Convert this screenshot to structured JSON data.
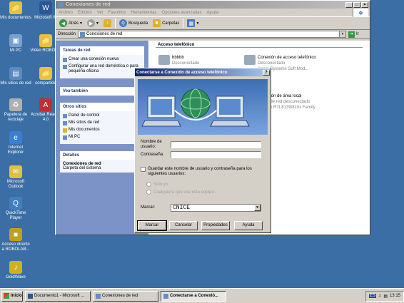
{
  "desktop": {
    "icons": [
      {
        "label": "Mis documentos",
        "color": "#e8c040"
      },
      {
        "label": "Microsoft W",
        "color": "#2b5797"
      },
      {
        "label": "Mi PC",
        "color": "#7aa0d0"
      },
      {
        "label": "Video ROBOL...",
        "color": "#e8c040"
      },
      {
        "label": "Mis sitios de red",
        "color": "#5a8ac0"
      },
      {
        "label": "compartido",
        "color": "#e8c040"
      },
      {
        "label": "Papelera de reciclaje",
        "color": "#b0b0b0"
      },
      {
        "label": "Acrobat Reader 4.0",
        "color": "#c03030"
      },
      {
        "label": "Internet Explorer",
        "color": "#3a7fd0"
      },
      {
        "label": "Microsoft Outlook",
        "color": "#e0c040"
      },
      {
        "label": "QuickTime Player",
        "color": "#4080c0"
      },
      {
        "label": "Acceso directo a ROBOLAB...",
        "color": "#c0a020"
      },
      {
        "label": "GoldWave",
        "color": "#d0b020"
      }
    ]
  },
  "explorer": {
    "title": "Conexiones de red",
    "menu": [
      "Archivo",
      "Edición",
      "Ver",
      "Favoritos",
      "Herramientas",
      "Opciones avanzadas",
      "Ayuda"
    ],
    "toolbar": {
      "back": "Atrás",
      "search": "Búsqueda",
      "folders": "Carpetas"
    },
    "address": {
      "label": "Dirección",
      "value": "Conexiones de red",
      "go": "Ir"
    },
    "tasks": {
      "title": "Tareas de red",
      "items": [
        "Crear una conexión nueva",
        "Configurar una red doméstica o para pequeña oficina"
      ]
    },
    "see_also": {
      "title": "Vea también"
    },
    "other_places": {
      "title": "Otros sitios",
      "items": [
        "Panel de control",
        "Mis sitios de red",
        "Mis documentos",
        "Mi PC"
      ]
    },
    "details": {
      "title": "Detalles",
      "name": "Conexiones de red",
      "sub": "Carpeta del sistema"
    },
    "group_dialup": "Acceso telefónico",
    "conn1": {
      "name": "bbbbb",
      "status": "Desconectado"
    },
    "conn2": {
      "name": "Conexión de acceso telefónico",
      "status": "Desconectado",
      "device": "Agere Systems Soft Mod..."
    },
    "conn3": {
      "name": "Conexión de área local",
      "status": "Cable de red desconectado",
      "device": "Realtek RTL8139/810x Family ..."
    }
  },
  "dialog": {
    "title": "Conectarse a Conexión de acceso telefónico",
    "username_label": "Nombre de usuario:",
    "username_value": "",
    "password_label": "Contraseña:",
    "password_value": "",
    "save_label": "Guardar este nombre de usuario y contraseña para los siguientes usuarios:",
    "radio_me": "Sólo yo",
    "radio_anyone": "Cualquiera que use este equipo",
    "dial_label": "Marcar:",
    "dial_value": "CNICE",
    "buttons": {
      "dial": "Marcar",
      "cancel": "Cancelar",
      "properties": "Propiedades",
      "help": "Ayuda"
    }
  },
  "taskbar": {
    "start": "Inicio",
    "tasks": [
      "Documento1 - Microsoft ...",
      "Conexiones de red",
      "Conectarse a Conexió..."
    ],
    "lang": "ES",
    "clock": "13:15"
  }
}
